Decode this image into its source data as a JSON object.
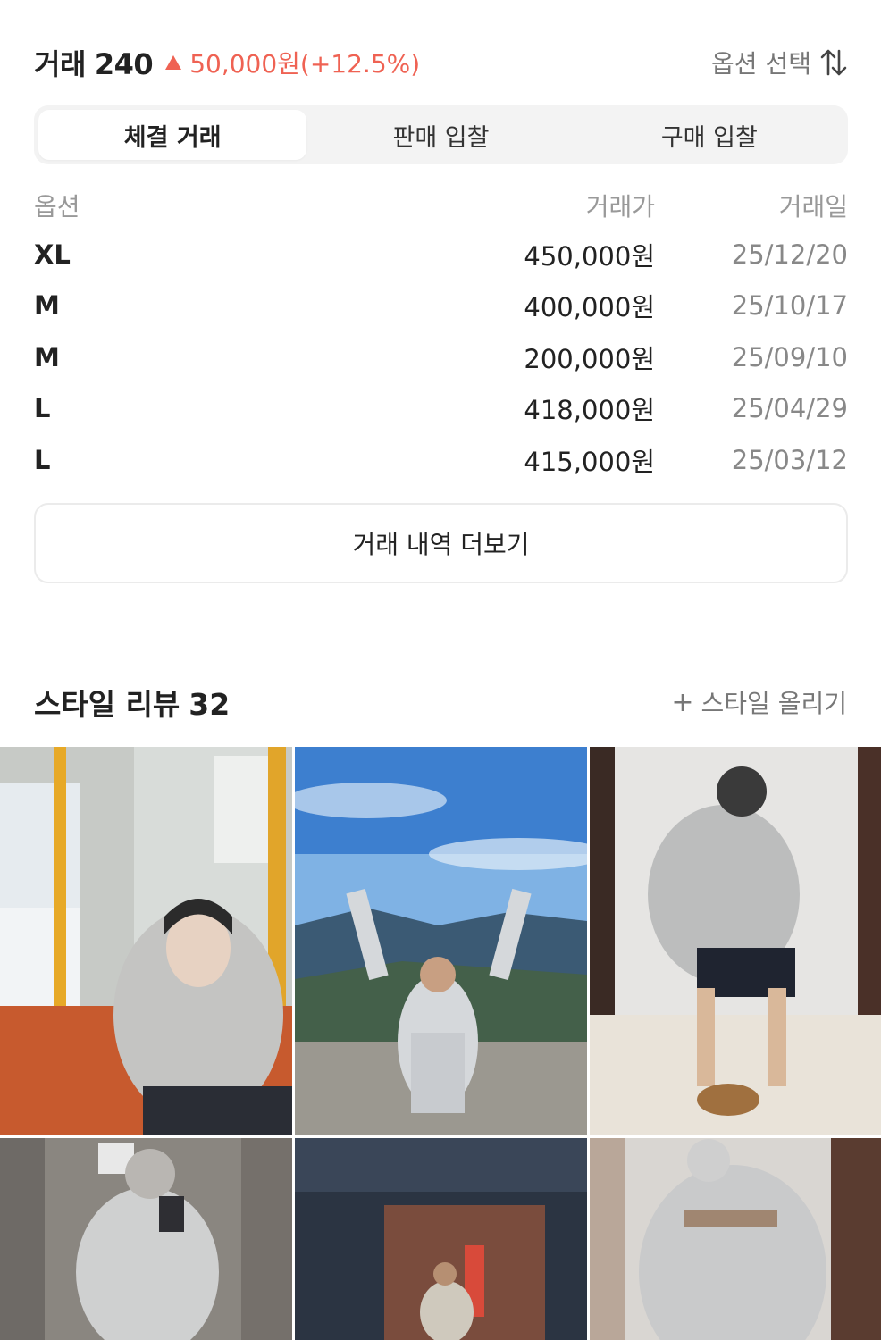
{
  "trade": {
    "title": "거래",
    "count": "240",
    "change": "50,000원(+12.5%)",
    "option_select_label": "옵션 선택"
  },
  "tabs": [
    {
      "label": "체결 거래",
      "active": true
    },
    {
      "label": "판매 입찰",
      "active": false
    },
    {
      "label": "구매 입찰",
      "active": false
    }
  ],
  "table": {
    "headers": {
      "option": "옵션",
      "price": "거래가",
      "date": "거래일"
    },
    "rows": [
      {
        "option": "XL",
        "price": "450,000원",
        "date": "25/12/20"
      },
      {
        "option": "M",
        "price": "400,000원",
        "date": "25/10/17"
      },
      {
        "option": "M",
        "price": "200,000원",
        "date": "25/09/10"
      },
      {
        "option": "L",
        "price": "418,000원",
        "date": "25/04/29"
      },
      {
        "option": "L",
        "price": "415,000원",
        "date": "25/03/12"
      }
    ]
  },
  "more_button_label": "거래 내역 더보기",
  "style_review": {
    "title": "스타일 리뷰",
    "count": "32",
    "upload_label": "스타일 올리기"
  },
  "colors": {
    "accent_red": "#ef6253",
    "muted": "#777777",
    "tab_bg": "#f3f3f3"
  },
  "icons": {
    "change_indicator": "triangle-up-icon",
    "sort": "sort-arrows-icon",
    "upload": "plus-icon"
  }
}
